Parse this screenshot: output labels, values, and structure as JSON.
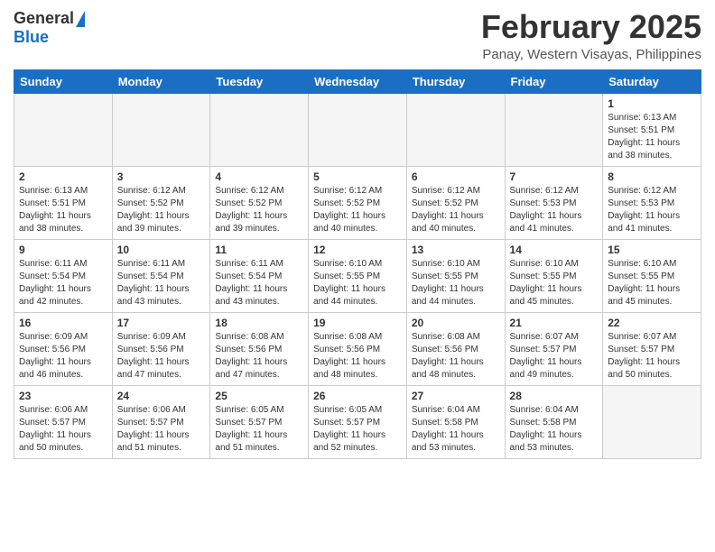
{
  "header": {
    "logo_general": "General",
    "logo_blue": "Blue",
    "month": "February 2025",
    "location": "Panay, Western Visayas, Philippines"
  },
  "days_of_week": [
    "Sunday",
    "Monday",
    "Tuesday",
    "Wednesday",
    "Thursday",
    "Friday",
    "Saturday"
  ],
  "weeks": [
    [
      {
        "day": "",
        "info": ""
      },
      {
        "day": "",
        "info": ""
      },
      {
        "day": "",
        "info": ""
      },
      {
        "day": "",
        "info": ""
      },
      {
        "day": "",
        "info": ""
      },
      {
        "day": "",
        "info": ""
      },
      {
        "day": "1",
        "info": "Sunrise: 6:13 AM\nSunset: 5:51 PM\nDaylight: 11 hours\nand 38 minutes."
      }
    ],
    [
      {
        "day": "2",
        "info": "Sunrise: 6:13 AM\nSunset: 5:51 PM\nDaylight: 11 hours\nand 38 minutes."
      },
      {
        "day": "3",
        "info": "Sunrise: 6:12 AM\nSunset: 5:52 PM\nDaylight: 11 hours\nand 39 minutes."
      },
      {
        "day": "4",
        "info": "Sunrise: 6:12 AM\nSunset: 5:52 PM\nDaylight: 11 hours\nand 39 minutes."
      },
      {
        "day": "5",
        "info": "Sunrise: 6:12 AM\nSunset: 5:52 PM\nDaylight: 11 hours\nand 40 minutes."
      },
      {
        "day": "6",
        "info": "Sunrise: 6:12 AM\nSunset: 5:52 PM\nDaylight: 11 hours\nand 40 minutes."
      },
      {
        "day": "7",
        "info": "Sunrise: 6:12 AM\nSunset: 5:53 PM\nDaylight: 11 hours\nand 41 minutes."
      },
      {
        "day": "8",
        "info": "Sunrise: 6:12 AM\nSunset: 5:53 PM\nDaylight: 11 hours\nand 41 minutes."
      }
    ],
    [
      {
        "day": "9",
        "info": "Sunrise: 6:11 AM\nSunset: 5:54 PM\nDaylight: 11 hours\nand 42 minutes."
      },
      {
        "day": "10",
        "info": "Sunrise: 6:11 AM\nSunset: 5:54 PM\nDaylight: 11 hours\nand 43 minutes."
      },
      {
        "day": "11",
        "info": "Sunrise: 6:11 AM\nSunset: 5:54 PM\nDaylight: 11 hours\nand 43 minutes."
      },
      {
        "day": "12",
        "info": "Sunrise: 6:10 AM\nSunset: 5:55 PM\nDaylight: 11 hours\nand 44 minutes."
      },
      {
        "day": "13",
        "info": "Sunrise: 6:10 AM\nSunset: 5:55 PM\nDaylight: 11 hours\nand 44 minutes."
      },
      {
        "day": "14",
        "info": "Sunrise: 6:10 AM\nSunset: 5:55 PM\nDaylight: 11 hours\nand 45 minutes."
      },
      {
        "day": "15",
        "info": "Sunrise: 6:10 AM\nSunset: 5:55 PM\nDaylight: 11 hours\nand 45 minutes."
      }
    ],
    [
      {
        "day": "16",
        "info": "Sunrise: 6:09 AM\nSunset: 5:56 PM\nDaylight: 11 hours\nand 46 minutes."
      },
      {
        "day": "17",
        "info": "Sunrise: 6:09 AM\nSunset: 5:56 PM\nDaylight: 11 hours\nand 47 minutes."
      },
      {
        "day": "18",
        "info": "Sunrise: 6:08 AM\nSunset: 5:56 PM\nDaylight: 11 hours\nand 47 minutes."
      },
      {
        "day": "19",
        "info": "Sunrise: 6:08 AM\nSunset: 5:56 PM\nDaylight: 11 hours\nand 48 minutes."
      },
      {
        "day": "20",
        "info": "Sunrise: 6:08 AM\nSunset: 5:56 PM\nDaylight: 11 hours\nand 48 minutes."
      },
      {
        "day": "21",
        "info": "Sunrise: 6:07 AM\nSunset: 5:57 PM\nDaylight: 11 hours\nand 49 minutes."
      },
      {
        "day": "22",
        "info": "Sunrise: 6:07 AM\nSunset: 5:57 PM\nDaylight: 11 hours\nand 50 minutes."
      }
    ],
    [
      {
        "day": "23",
        "info": "Sunrise: 6:06 AM\nSunset: 5:57 PM\nDaylight: 11 hours\nand 50 minutes."
      },
      {
        "day": "24",
        "info": "Sunrise: 6:06 AM\nSunset: 5:57 PM\nDaylight: 11 hours\nand 51 minutes."
      },
      {
        "day": "25",
        "info": "Sunrise: 6:05 AM\nSunset: 5:57 PM\nDaylight: 11 hours\nand 51 minutes."
      },
      {
        "day": "26",
        "info": "Sunrise: 6:05 AM\nSunset: 5:57 PM\nDaylight: 11 hours\nand 52 minutes."
      },
      {
        "day": "27",
        "info": "Sunrise: 6:04 AM\nSunset: 5:58 PM\nDaylight: 11 hours\nand 53 minutes."
      },
      {
        "day": "28",
        "info": "Sunrise: 6:04 AM\nSunset: 5:58 PM\nDaylight: 11 hours\nand 53 minutes."
      },
      {
        "day": "",
        "info": ""
      }
    ]
  ]
}
